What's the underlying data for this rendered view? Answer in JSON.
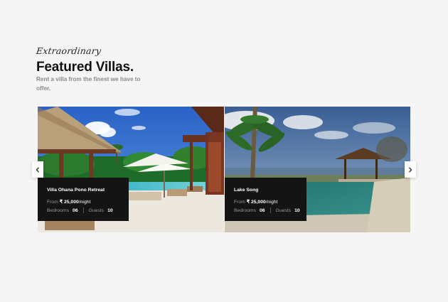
{
  "section": {
    "eyebrow": "Extraordinary",
    "title": "Featured Villas.",
    "subtitle": "Rent a villa from the finest we have to offer."
  },
  "carousel": {
    "prev_icon": "chevron-left-icon",
    "next_icon": "chevron-right-icon",
    "villas": [
      {
        "name": "Villa Ohana Pono Retreat",
        "price_label": "From",
        "price": "₹ 25,000",
        "price_unit": "/night",
        "bedrooms_label": "Bedrooms",
        "bedrooms": "06",
        "guests_label": "Guests",
        "guests": "10"
      },
      {
        "name": "Lake Song",
        "price_label": "From",
        "price": "₹ 25,000",
        "price_unit": "/night",
        "bedrooms_label": "Bedrooms",
        "bedrooms": "06",
        "guests_label": "Guests",
        "guests": "10"
      }
    ]
  },
  "colors": {
    "background": "#f5f5f5",
    "info_panel": "#141414",
    "muted_text": "#8a8a8a"
  }
}
